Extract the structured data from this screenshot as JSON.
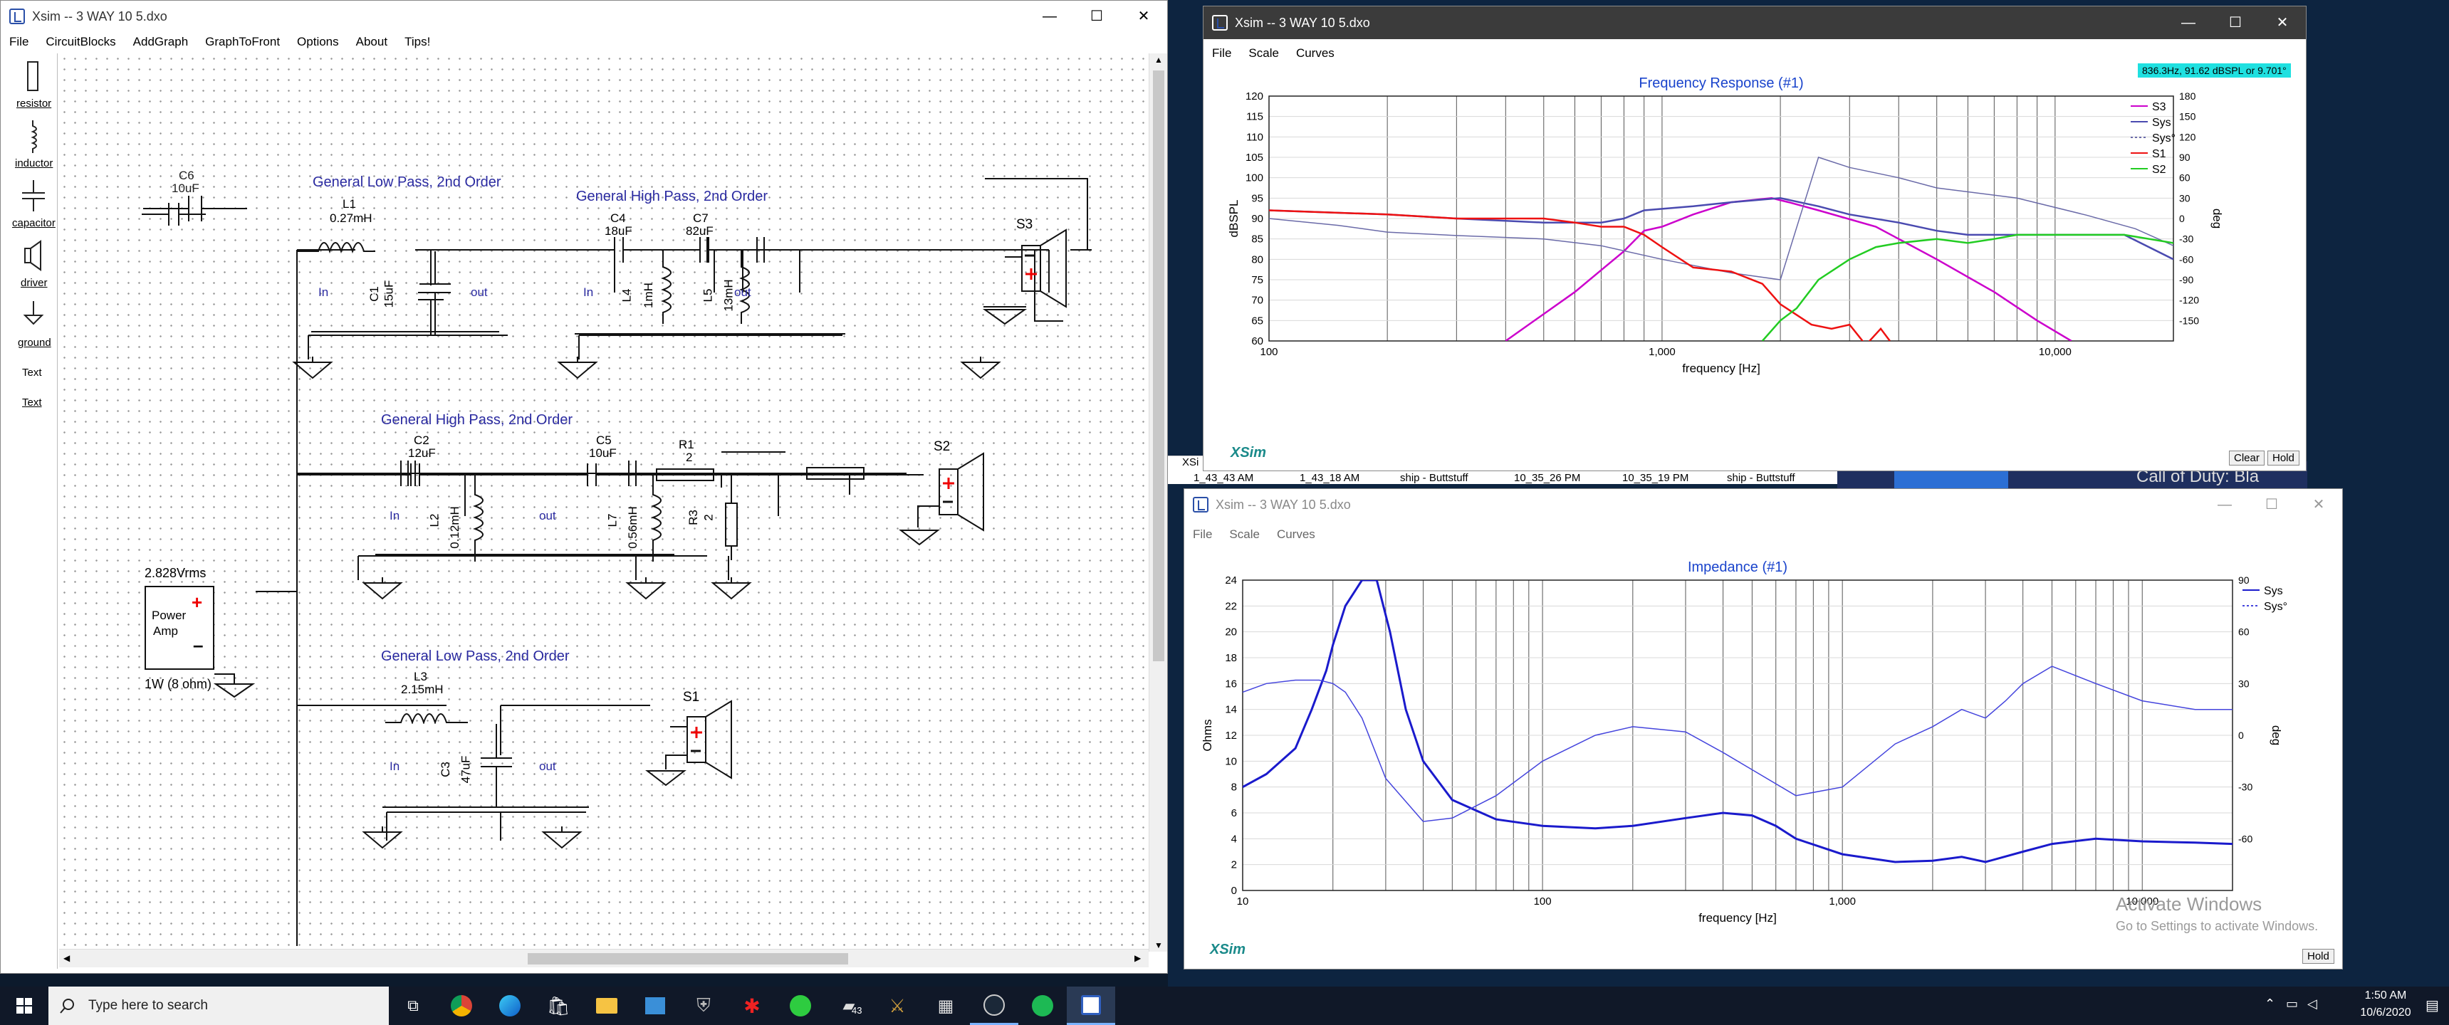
{
  "circuit_window": {
    "title": "Xsim -- 3 WAY 10 5.dxo",
    "menu": [
      "File",
      "CircuitBlocks",
      "AddGraph",
      "GraphToFront",
      "Options",
      "About",
      "Tips!"
    ],
    "palette": [
      "resistor",
      "inductor",
      "capacitor",
      "driver",
      "ground",
      "Text",
      "Text"
    ],
    "blocks": {
      "lp1": "General Low Pass, 2nd Order",
      "hp1": "General High Pass, 2nd Order",
      "hp2": "General High Pass, 2nd Order",
      "lp2": "General Low Pass, 2nd Order"
    },
    "components": {
      "c6": "C6",
      "c6v": "10uF",
      "l1": "L1",
      "l1v": "0.27mH",
      "c1": "C1",
      "c1v": "15uF",
      "c4": "C4",
      "c4v": "18uF",
      "c7": "C7",
      "c7v": "82uF",
      "l4": "L4",
      "l4v": "1mH",
      "l5": "L5",
      "l5v": "13mH",
      "c2": "C2",
      "c2v": "12uF",
      "c5": "C5",
      "c5v": "10uF",
      "l2": "L2",
      "l2v": "0.12mH",
      "l7": "L7",
      "l7v": "0.56mH",
      "r1": "R1",
      "r1v": "2",
      "r3": "R3",
      "r3v": "2",
      "l3": "L3",
      "l3v": "2.15mH",
      "c3": "C3",
      "c3v": "47uF",
      "s1": "S1",
      "s2": "S2",
      "s3": "S3",
      "amp_volts": "2.828Vrms",
      "amp_label1": "Power",
      "amp_label2": "Amp",
      "amp_power": "1W (8 ohm)",
      "in": "In",
      "out": "out"
    }
  },
  "freq_window": {
    "title": "Xsim -- 3 WAY 10 5.dxo",
    "menu": [
      "File",
      "Scale",
      "Curves"
    ],
    "readout": "836.3Hz, 91.62 dBSPL or 9.701°",
    "buttons": {
      "clear": "Clear",
      "hold": "Hold"
    },
    "brand": "XSim"
  },
  "imp_window": {
    "title": "Xsim -- 3 WAY 10 5.dxo",
    "menu": [
      "File",
      "Scale",
      "Curves"
    ],
    "buttons": {
      "hold": "Hold"
    },
    "brand": "XSim",
    "watermark_title": "Activate Windows",
    "watermark_sub": "Go to Settings to activate Windows."
  },
  "background_strip": {
    "cells": [
      "1_43_43 AM",
      "1_43_18 AM",
      "ship - Buttstuff",
      "10_35_26 PM",
      "10_35_19 PM",
      "ship - Buttstuff"
    ],
    "xsi": "XSi",
    "game": "Call of Duty: Bla"
  },
  "taskbar": {
    "search_placeholder": "Type here to search",
    "time": "1:50 AM",
    "date": "10/6/2020",
    "badge": "43"
  },
  "chart_data": [
    {
      "type": "line",
      "title": "Frequency Response (#1)",
      "xlabel": "frequency [Hz]",
      "ylabel": "dBSPL",
      "y2label": "deg",
      "x_scale": "log",
      "xlim": [
        100,
        20000
      ],
      "ylim": [
        60,
        120
      ],
      "y2lim": [
        -180,
        180
      ],
      "x_ticks": [
        "100",
        "1,000",
        "10,000"
      ],
      "y_ticks": [
        60,
        65,
        70,
        75,
        80,
        85,
        90,
        95,
        100,
        105,
        110,
        115,
        120
      ],
      "y2_ticks": [
        -150,
        -120,
        -90,
        -60,
        -30,
        0,
        30,
        60,
        90,
        120,
        150,
        180
      ],
      "legend_position": "top-right",
      "series": [
        {
          "name": "S3",
          "color": "#cc00cc",
          "x": [
            400,
            600,
            800,
            900,
            1000,
            1200,
            1500,
            1900,
            2100,
            2500,
            3500,
            5000,
            7000,
            9000,
            11000
          ],
          "y": [
            60,
            72,
            82,
            87,
            88,
            91,
            94,
            95,
            94,
            92,
            88,
            80,
            72,
            65,
            60
          ]
        },
        {
          "name": "Sys",
          "color": "#4a4ab0",
          "x": [
            100,
            200,
            300,
            500,
            700,
            800,
            900,
            1200,
            1500,
            2000,
            2500,
            3000,
            4000,
            5000,
            6000,
            7000,
            9000,
            12000,
            15000,
            20000
          ],
          "y": [
            92,
            91,
            90,
            89,
            89,
            90,
            92,
            93,
            94,
            95,
            93,
            91,
            89,
            87,
            86,
            86,
            86,
            86,
            86,
            80
          ]
        },
        {
          "name": "Sys°",
          "color": "#6a6aa8",
          "dashed": true,
          "x": [
            100,
            150,
            200,
            300,
            500,
            700,
            1000,
            1500,
            2000,
            2500,
            3000,
            4000,
            5000,
            8000,
            12000,
            16000,
            20000
          ],
          "y": [
            0,
            -10,
            -20,
            -25,
            -30,
            -40,
            -60,
            -80,
            -90,
            90,
            75,
            60,
            45,
            30,
            5,
            -15,
            -40
          ]
        },
        {
          "name": "S1",
          "color": "#ee1111",
          "x": [
            100,
            200,
            300,
            500,
            600,
            700,
            800,
            900,
            1000,
            1200,
            1500,
            1800,
            2000,
            2400,
            2700,
            3000,
            3300,
            3600,
            3800
          ],
          "y": [
            92,
            91,
            90,
            90,
            89,
            88,
            88,
            86,
            83,
            78,
            77,
            74,
            69,
            64,
            63,
            64,
            59,
            63,
            60
          ]
        },
        {
          "name": "S2",
          "color": "#22cc22",
          "x": [
            1800,
            2000,
            2200,
            2500,
            3000,
            3500,
            4000,
            5000,
            6000,
            7000,
            8000,
            10000,
            12000,
            15000,
            20000
          ],
          "y": [
            60,
            65,
            68,
            75,
            80,
            83,
            84,
            85,
            84,
            85,
            86,
            86,
            86,
            86,
            84
          ]
        }
      ]
    },
    {
      "type": "line",
      "title": "Impedance (#1)",
      "xlabel": "frequency [Hz]",
      "ylabel": "Ohms",
      "y2label": "deg",
      "x_scale": "log",
      "xlim": [
        10,
        20000
      ],
      "ylim": [
        0,
        24
      ],
      "y2lim": [
        -90,
        90
      ],
      "x_ticks": [
        "10",
        "100",
        "1,000",
        "10,000"
      ],
      "y_ticks": [
        0,
        2,
        4,
        6,
        8,
        10,
        12,
        14,
        16,
        18,
        20,
        22,
        24
      ],
      "y2_ticks": [
        -60,
        -30,
        0,
        30,
        60,
        90
      ],
      "legend_position": "top-right",
      "series": [
        {
          "name": "Sys",
          "color": "#1a1acc",
          "x": [
            10,
            12,
            15,
            17,
            19,
            20,
            22,
            25,
            28,
            31,
            35,
            40,
            50,
            70,
            100,
            150,
            200,
            300,
            400,
            500,
            600,
            700,
            1000,
            1500,
            2000,
            2500,
            3000,
            4000,
            5000,
            7000,
            10000,
            15000,
            20000
          ],
          "y": [
            8,
            9,
            11,
            14,
            17,
            19,
            22,
            24,
            24,
            20,
            14,
            10,
            7,
            5.5,
            5,
            4.8,
            5,
            5.6,
            6,
            5.8,
            5,
            4,
            2.8,
            2.2,
            2.3,
            2.6,
            2.2,
            3,
            3.6,
            4,
            3.8,
            3.7,
            3.6
          ]
        },
        {
          "name": "Sys°",
          "color": "#4444dd",
          "dashed": true,
          "x": [
            10,
            12,
            15,
            18,
            20,
            22,
            25,
            30,
            40,
            50,
            70,
            100,
            150,
            200,
            300,
            400,
            500,
            700,
            1000,
            1500,
            2000,
            2500,
            3000,
            3500,
            4000,
            5000,
            7000,
            10000,
            15000,
            20000
          ],
          "y": [
            25,
            30,
            32,
            32,
            30,
            25,
            10,
            -25,
            -50,
            -48,
            -35,
            -15,
            0,
            5,
            2,
            -10,
            -20,
            -35,
            -30,
            -5,
            5,
            15,
            10,
            20,
            30,
            40,
            30,
            20,
            15,
            15
          ]
        }
      ]
    }
  ]
}
